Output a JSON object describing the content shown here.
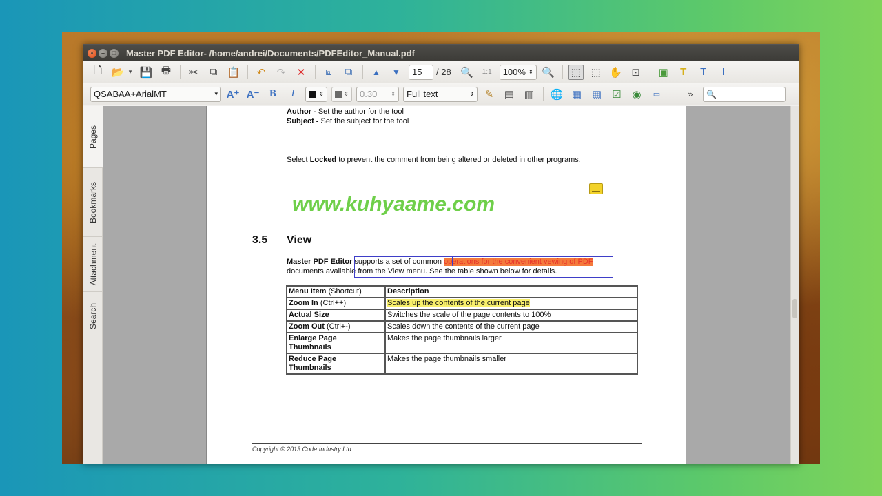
{
  "window": {
    "title": "Master PDF Editor- /home/andrei/Documents/PDFEditor_Manual.pdf"
  },
  "toolbar1": {
    "page_current": "15",
    "page_total": "/ 28",
    "zoom": "100%"
  },
  "toolbar2": {
    "font_name": "QSABAA+ArialMT",
    "line_width": "0.30",
    "text_mode": "Full text",
    "more": "»"
  },
  "side_tabs": [
    "Pages",
    "Bookmarks",
    "Attachment",
    "Search"
  ],
  "document": {
    "author_label": "Author -",
    "author_text": " Set the author for the tool",
    "subject_label": "Subject -",
    "subject_text": "  Set the subject for the tool",
    "locked_pre": "Select ",
    "locked_bold": "Locked",
    "locked_post": " to prevent the comment from being altered or deleted in other programs.",
    "watermark": "www.kuhyaame.com",
    "section_number": "3.5",
    "section_title": "View",
    "para_bold": "Master PDF Editor",
    "para_1": " supports a set of common ",
    "para_hl": "operations for the convenient vewing of PDF",
    "para_2": "documents available from the View menu. See the table shown below for details.",
    "table": {
      "header": {
        "c1_bold": "Menu Item",
        "c1_rest": " (Shortcut)",
        "c2": "Description"
      },
      "rows": [
        {
          "bold": "Zoom In",
          "rest": " (Ctrl++)",
          "desc": "Scales up the contents of the current page"
        },
        {
          "bold": "Actual Size",
          "rest": "",
          "desc": "Switches the scale of the page contents to 100%"
        },
        {
          "bold": "Zoom Out",
          "rest": " (Ctrl+-)",
          "desc": "Scales down the contents of the current page"
        },
        {
          "bold": "Enlarge Page Thumbnails",
          "rest": "",
          "desc": "Makes the page thumbnails larger"
        },
        {
          "bold": "Reduce Page Thumbnails",
          "rest": "",
          "desc": "Makes the page thumbnails smaller"
        }
      ]
    },
    "footer": "Copyright © 2013 Code Industry Ltd."
  },
  "colors": {
    "highlight_orange": "#f47a3c",
    "highlight_yellow": "#f8ef6b",
    "watermark": "#6fcf4a"
  }
}
